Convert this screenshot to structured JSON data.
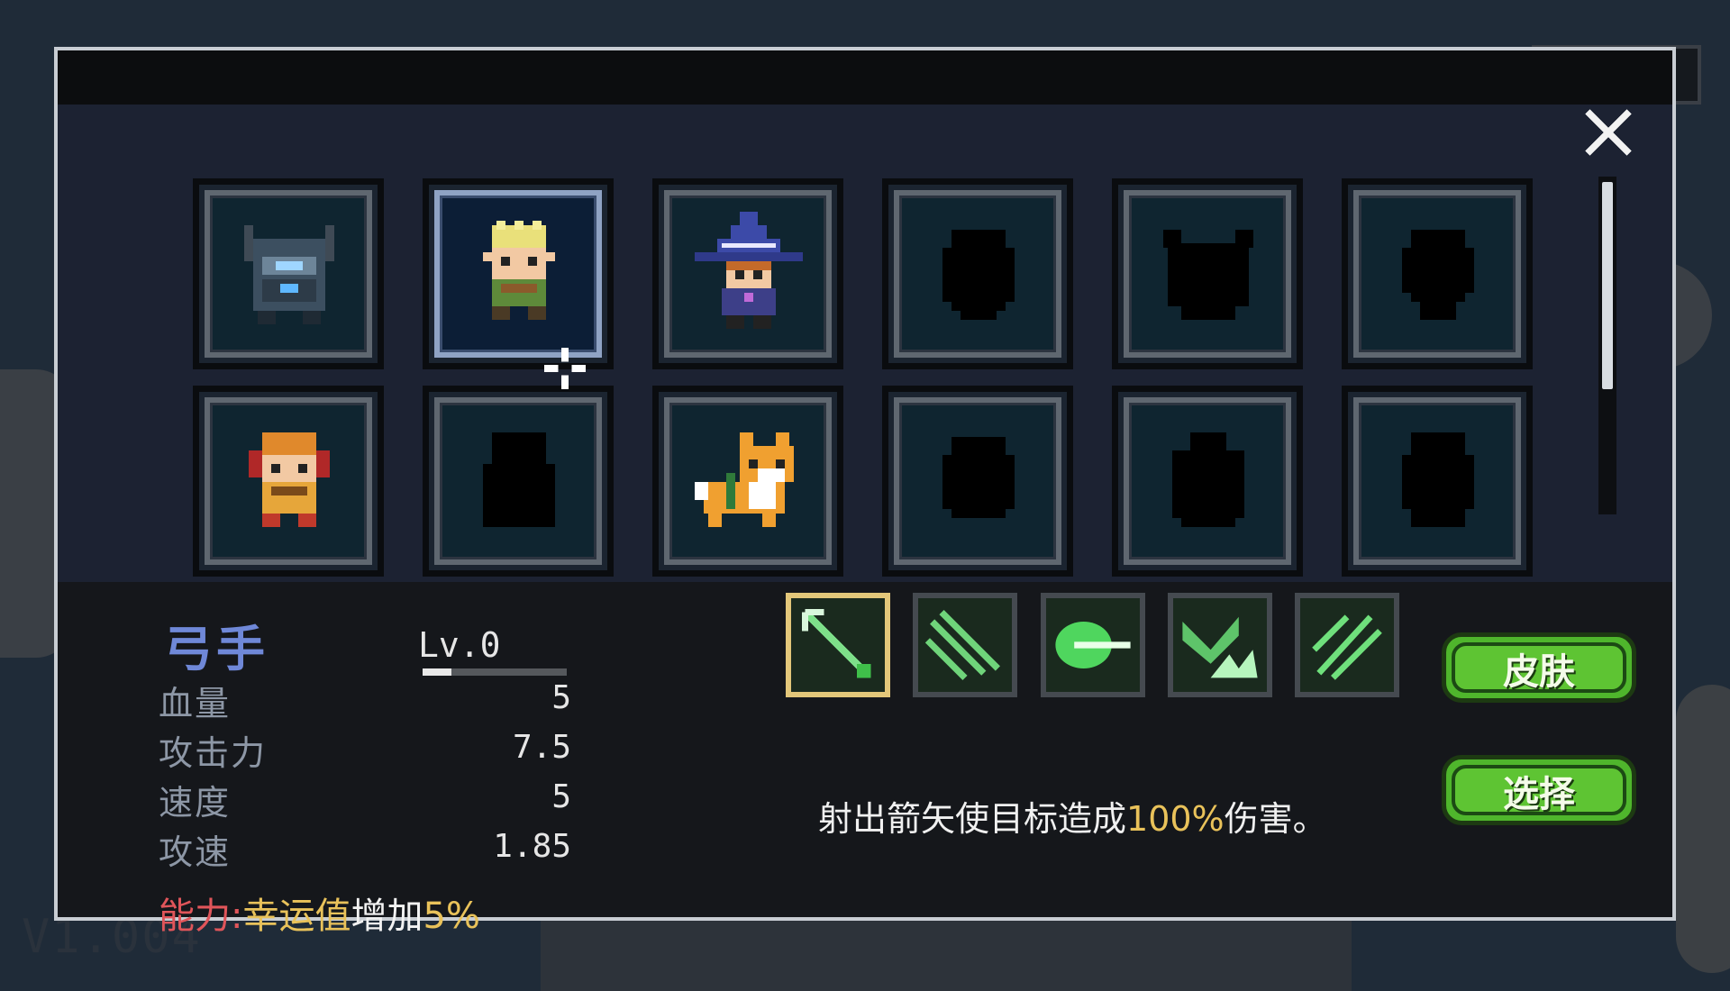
{
  "version_text": "V1.004",
  "character_grid": [
    {
      "id": "knight",
      "name_hidden": true,
      "unlocked": true
    },
    {
      "id": "archer",
      "unlocked": true,
      "selected": true
    },
    {
      "id": "wizard",
      "unlocked": true
    },
    {
      "id": "locked-4",
      "unlocked": false
    },
    {
      "id": "locked-5",
      "unlocked": false
    },
    {
      "id": "locked-6",
      "unlocked": false
    },
    {
      "id": "engineer",
      "unlocked": true
    },
    {
      "id": "locked-8",
      "unlocked": false
    },
    {
      "id": "fox",
      "unlocked": true
    },
    {
      "id": "locked-10",
      "unlocked": false
    },
    {
      "id": "locked-11",
      "unlocked": false
    },
    {
      "id": "locked-12",
      "unlocked": false
    }
  ],
  "scroll_position_fraction": 0.0,
  "character": {
    "name": "弓手",
    "level": "Lv.0",
    "level_progress": 0.2,
    "stats": [
      {
        "label": "血量",
        "value": "5"
      },
      {
        "label": "攻击力",
        "value": "7.5"
      },
      {
        "label": "速度",
        "value": "5"
      },
      {
        "label": "攻速",
        "value": "1.85"
      }
    ],
    "ability": {
      "prefix": "能力:",
      "name": "幸运值",
      "verb": "增加",
      "amount": "5%"
    }
  },
  "skills": [
    {
      "icon": "arrow-icon",
      "active": true
    },
    {
      "icon": "multi-arrow-icon",
      "active": false
    },
    {
      "icon": "green-blast-icon",
      "active": false
    },
    {
      "icon": "ground-spike-icon",
      "active": false
    },
    {
      "icon": "arrow-rain-icon",
      "active": false
    }
  ],
  "skill_description": {
    "before": "射出箭矢使目标造成",
    "highlight": "100%",
    "after": "伤害。"
  },
  "buttons": {
    "skin": "皮肤",
    "select": "选择"
  },
  "colors": {
    "accent_green": "#4fb62c",
    "name_blue": "#6f88d8",
    "highlight_gold": "#e9c25a",
    "ability_red": "#e0555a",
    "panel_bg": "#15171b"
  }
}
